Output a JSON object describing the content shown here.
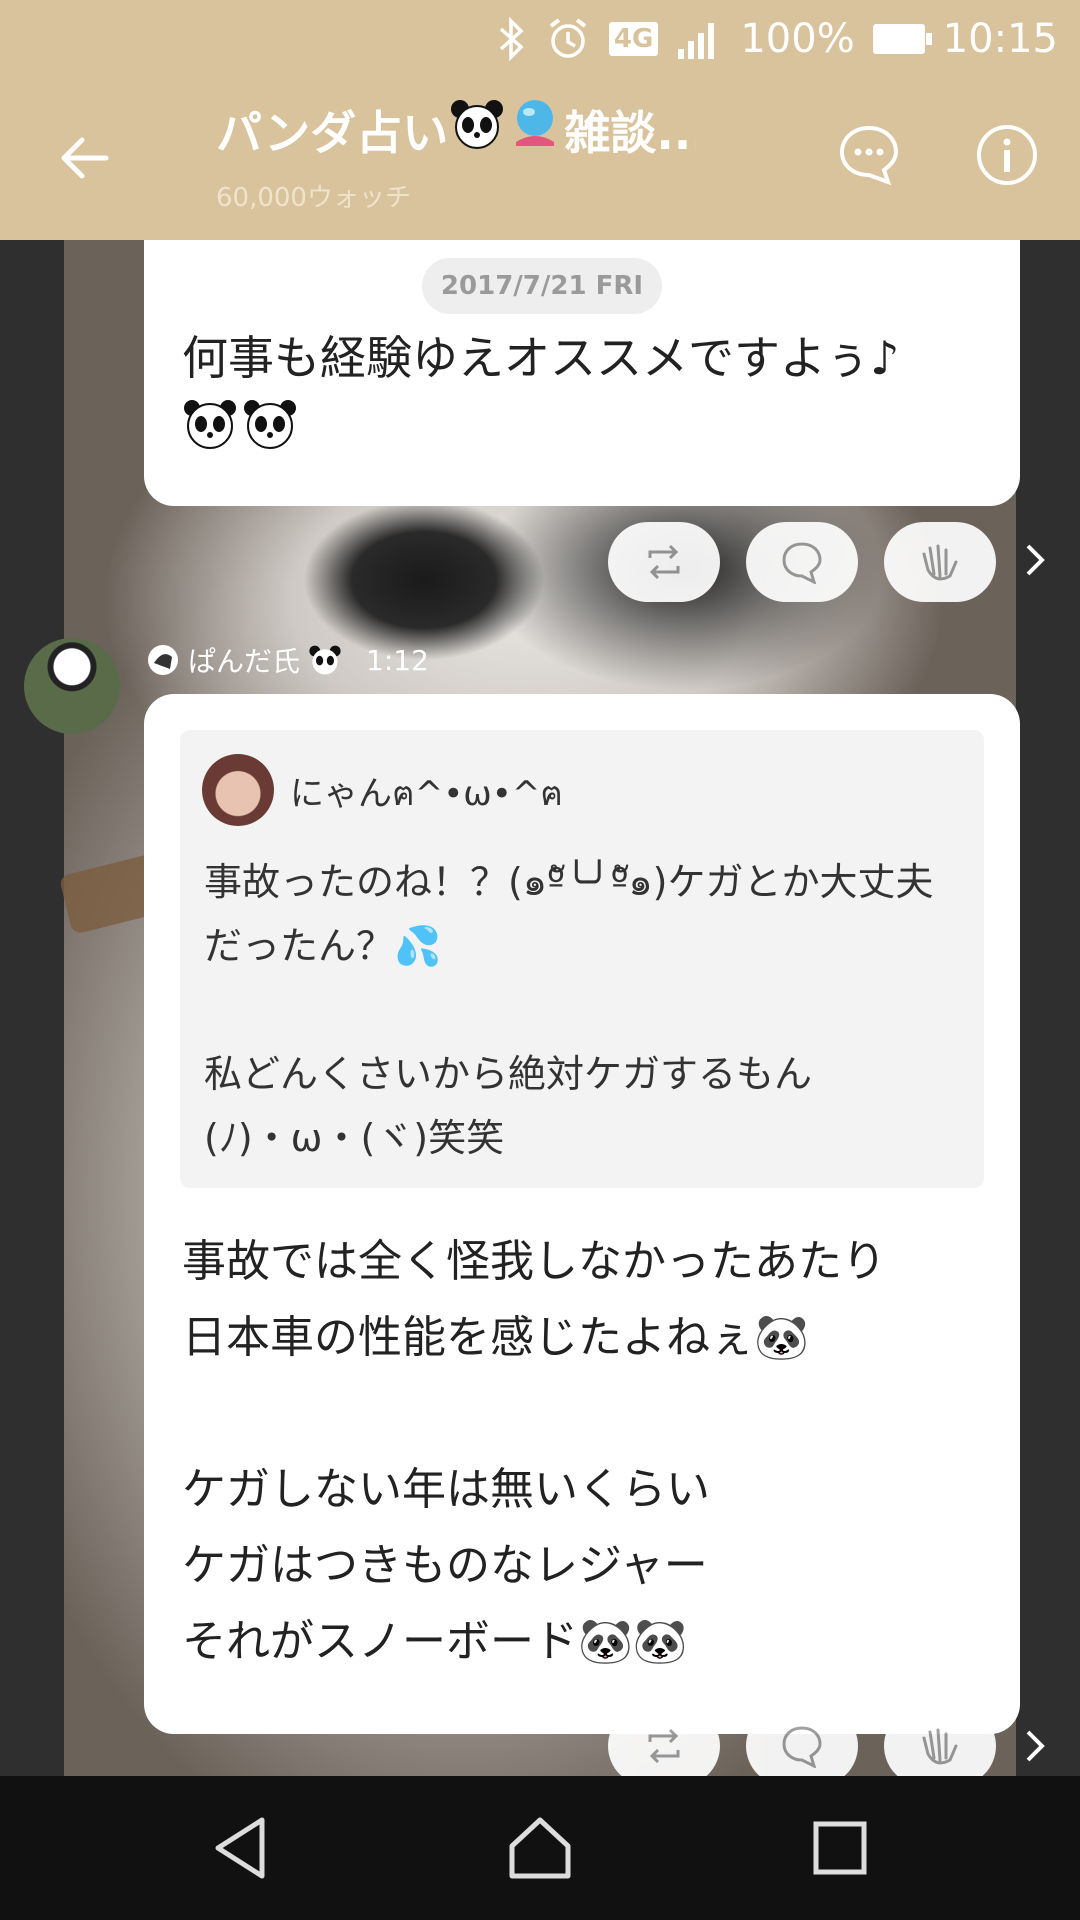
{
  "status_bar": {
    "network": "4G",
    "battery": "100%",
    "time": "10:15",
    "icons": [
      "bluetooth-icon",
      "alarm-icon",
      "signal-icon",
      "battery-icon"
    ]
  },
  "header": {
    "title": "パンダ占い",
    "title_suffix": "雑談...",
    "watch_count": "60,000ウォッチ",
    "icons": [
      "back-arrow-icon",
      "chat-bubble-icon",
      "info-icon"
    ]
  },
  "messages": [
    {
      "date": "2017/7/21 FRI",
      "text": "何事も経験ゆえオススメですよぅ♪"
    },
    {
      "sender": "ぱんだ氏",
      "time": "1:12",
      "quote": {
        "name": "にゃんฅ^•ω•^ฅ",
        "text": "事故ったのね！？(๑ºั╰╯ºั๑)ケガとか大丈夫だったん？💦\n\n私どんくさいから絶対ケガするもん\n(ﾉ)・ω・(ヾ)笑笑"
      },
      "text": "事故では全く怪我しなかったあたり\n日本車の性能を感じたよねぇ🐼\n\nケガしない年は無いくらい\nケガはつきものなレジャー\nそれがスノーボード🐼🐼"
    }
  ],
  "actions": [
    "repost-icon",
    "comment-icon",
    "clap-icon",
    "chevron-right-icon"
  ],
  "nav": [
    "nav-back-icon",
    "nav-home-icon",
    "nav-recent-icon"
  ],
  "colors": {
    "header_bg": "#d9c39d",
    "bubble": "#ffffff",
    "quote_bg": "#f3f3f3"
  }
}
